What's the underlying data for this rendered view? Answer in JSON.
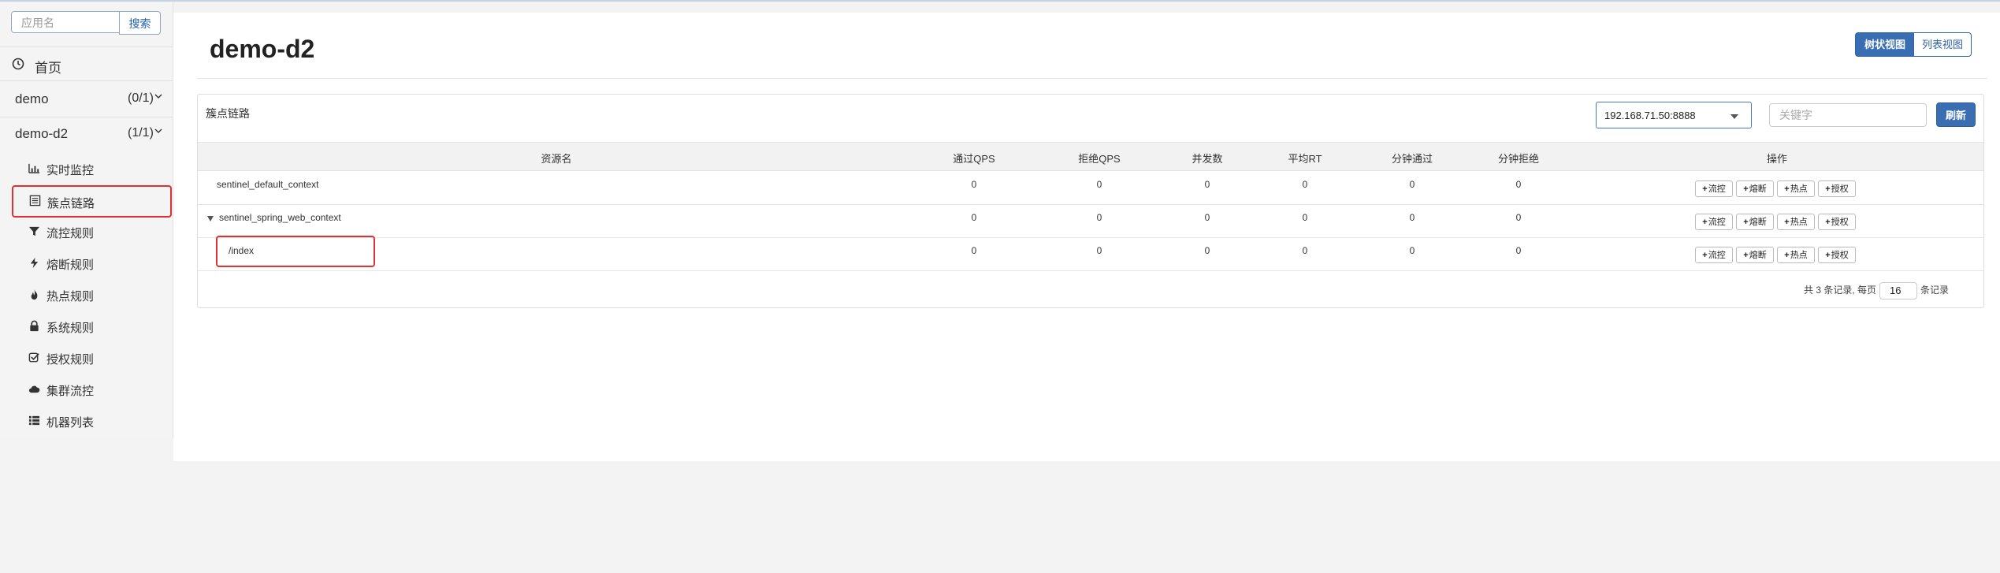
{
  "sidebar": {
    "search": {
      "placeholder": "应用名",
      "button": "搜索"
    },
    "home": {
      "label": "首页",
      "icon": "clock-icon"
    },
    "apps": [
      {
        "name": "demo",
        "count": "(0/1)"
      },
      {
        "name": "demo-d2",
        "count": "(1/1)"
      }
    ],
    "menu": [
      {
        "label": "实时监控",
        "icon": "bar-chart-icon"
      },
      {
        "label": "簇点链路",
        "icon": "list-icon"
      },
      {
        "label": "流控规则",
        "icon": "filter-icon"
      },
      {
        "label": "熔断规则",
        "icon": "bolt-icon"
      },
      {
        "label": "热点规则",
        "icon": "fire-icon"
      },
      {
        "label": "系统规则",
        "icon": "lock-icon"
      },
      {
        "label": "授权规则",
        "icon": "check-icon"
      },
      {
        "label": "集群流控",
        "icon": "cloud-icon"
      },
      {
        "label": "机器列表",
        "icon": "th-list-icon"
      }
    ],
    "active_index": 1
  },
  "main": {
    "title": "demo-d2",
    "view_toggle": {
      "tree": "树状视图",
      "list": "列表视图",
      "active": "tree"
    },
    "panel": {
      "title": "簇点链路",
      "machine": "192.168.71.50:8888",
      "keyword_placeholder": "关键字",
      "refresh": "刷新"
    },
    "table": {
      "columns": [
        "资源名",
        "通过QPS",
        "拒绝QPS",
        "并发数",
        "平均RT",
        "分钟通过",
        "分钟拒绝",
        "操作"
      ],
      "rows": [
        {
          "name": "sentinel_default_context",
          "expandable": false,
          "pass_qps": "0",
          "block_qps": "0",
          "concurrency": "0",
          "avg_rt": "0",
          "minute_pass": "0",
          "minute_block": "0"
        },
        {
          "name": "sentinel_spring_web_context",
          "expandable": true,
          "pass_qps": "0",
          "block_qps": "0",
          "concurrency": "0",
          "avg_rt": "0",
          "minute_pass": "0",
          "minute_block": "0"
        },
        {
          "name": "/index",
          "expandable": false,
          "pass_qps": "0",
          "block_qps": "0",
          "concurrency": "0",
          "avg_rt": "0",
          "minute_pass": "0",
          "minute_block": "0"
        }
      ],
      "actions": [
        "流控",
        "熔断",
        "热点",
        "授权"
      ]
    },
    "pagination": {
      "prefix": "共 3 条记录, 每页",
      "page_size": "16",
      "suffix": "条记录"
    }
  },
  "colors": {
    "primary": "#3a6eb3",
    "highlight_border": "#e03030"
  }
}
